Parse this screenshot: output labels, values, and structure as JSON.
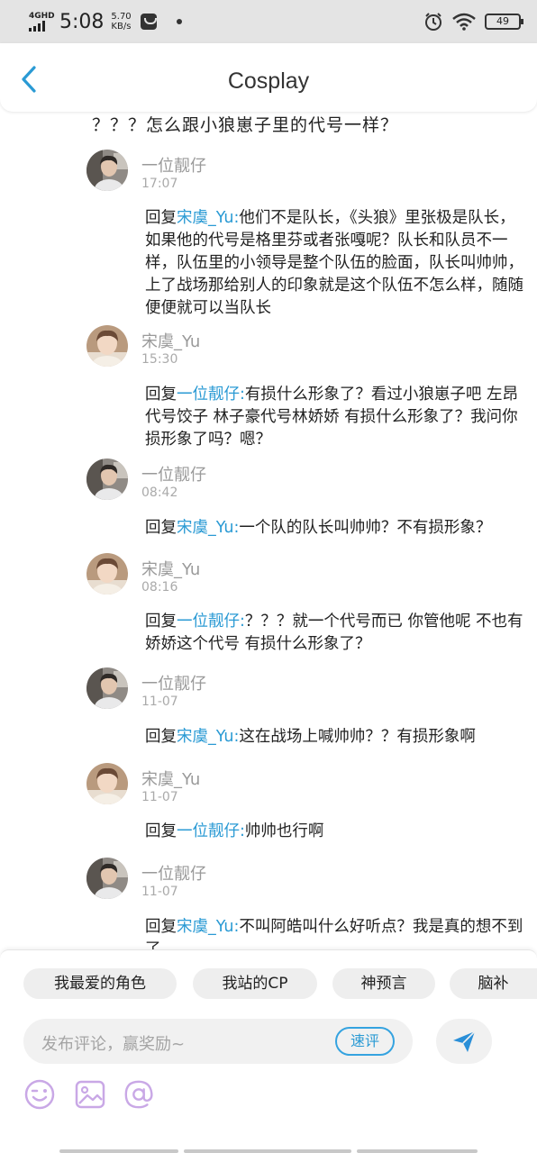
{
  "status_bar": {
    "network_type": "4GHD",
    "time": "5:08",
    "speed_value": "5.70",
    "speed_unit": "KB/s",
    "battery": "49"
  },
  "header": {
    "title": "Cosplay",
    "back_icon": "chevron-left-icon"
  },
  "thread": {
    "top_snippet": "？？？怎么跟小狼崽子里的代号一样？",
    "reply_prefix": "回复",
    "comments": [
      {
        "user": "一位靓仔",
        "time": "17:07",
        "reply_to": "宋虞_Yu:",
        "text": "他们不是队长，《头狼》里张极是队长，如果他的代号是格里芬或者张嘎呢？队长和队员不一样，队伍里的小领导是整个队伍的脸面，队长叫帅帅，上了战场那给别人的印象就是这个队伍不怎么样，随随便便就可以当队长"
      },
      {
        "user": "宋虞_Yu",
        "time": "15:30",
        "reply_to": "一位靓仔:",
        "text": "有损什么形象了？看过小狼崽子吧 左昂代号饺子 林子豪代号林娇娇 有损什么形象了？我问你 损形象了吗？嗯？"
      },
      {
        "user": "一位靓仔",
        "time": "08:42",
        "reply_to": "宋虞_Yu:",
        "text": "一个队的队长叫帅帅？不有损形象？"
      },
      {
        "user": "宋虞_Yu",
        "time": "08:16",
        "reply_to": "一位靓仔:",
        "text": "？？？就一个代号而已 你管他呢 不也有娇娇这个代号 有损什么形象了？"
      },
      {
        "user": "一位靓仔",
        "time": "11-07",
        "reply_to": "宋虞_Yu:",
        "text": "这在战场上喊帅帅？？有损形象啊"
      },
      {
        "user": "宋虞_Yu",
        "time": "11-07",
        "reply_to": "一位靓仔:",
        "text": "帅帅也行啊"
      },
      {
        "user": "一位靓仔",
        "time": "11-07",
        "reply_to": "宋虞_Yu:",
        "text": "不叫阿皓叫什么好听点？我是真的想不到了"
      }
    ]
  },
  "quick_tags": [
    "我最爱的角色",
    "我站的CP",
    "神预言",
    "脑补"
  ],
  "comment_input": {
    "placeholder": "发布评论，赢奖励~",
    "quick_label": "速评"
  },
  "tools": [
    "emoji-icon",
    "image-icon",
    "at-icon"
  ],
  "colors": {
    "accent": "#2a9ad4",
    "send": "#2a8fd8",
    "tool_icons": "#c9a8e6",
    "status_bar_bg": "#e4e4e4"
  }
}
